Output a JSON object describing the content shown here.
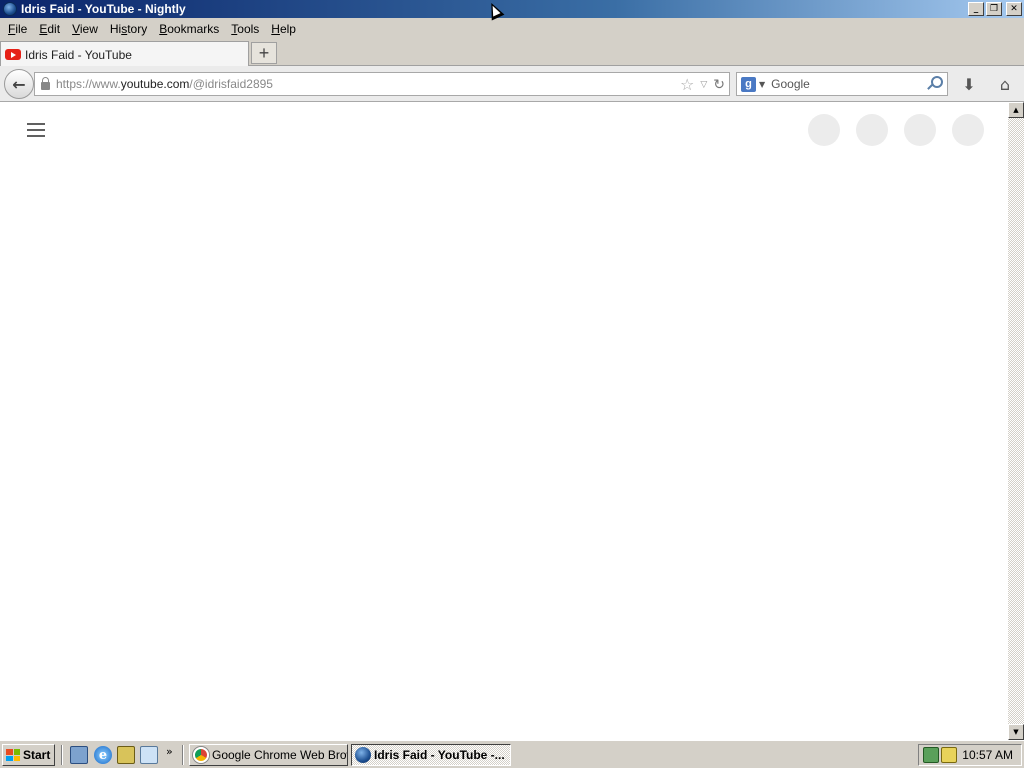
{
  "window": {
    "title": "Idris Faid - YouTube - Nightly",
    "minimize": "_",
    "maximize": "❐",
    "close": "✕"
  },
  "menubar": {
    "items": [
      {
        "prefix": "",
        "u": "F",
        "rest": "ile"
      },
      {
        "prefix": "",
        "u": "E",
        "rest": "dit"
      },
      {
        "prefix": "",
        "u": "V",
        "rest": "iew"
      },
      {
        "prefix": "Hi",
        "u": "s",
        "rest": "tory"
      },
      {
        "prefix": "",
        "u": "B",
        "rest": "ookmarks"
      },
      {
        "prefix": "",
        "u": "T",
        "rest": "ools"
      },
      {
        "prefix": "",
        "u": "H",
        "rest": "elp"
      }
    ]
  },
  "tabs": {
    "active_label": "Idris Faid - YouTube",
    "new_tab": "+"
  },
  "navbar": {
    "back": "←",
    "url_prefix": "https://www.",
    "url_host": "youtube.com",
    "url_path": "/@idrisfaid2895",
    "star": "☆",
    "dropdown": "▽",
    "reload": "↻",
    "search_engine": "g",
    "search_dropdown": "▼",
    "search_placeholder": "Google",
    "download": "⬇",
    "home": "⌂"
  },
  "scrollbar": {
    "up": "▲",
    "down": "▼"
  },
  "taskbar": {
    "start": "Start",
    "more": "»",
    "tasks": [
      {
        "label": "Google Chrome Web Brow..."
      },
      {
        "label": "Idris Faid - YouTube -..."
      }
    ],
    "clock": "10:57 AM"
  },
  "colors": {
    "titlebar_start": "#0a246a",
    "youtube_red": "#e62117",
    "chrome_gray": "#d4d0c8"
  }
}
